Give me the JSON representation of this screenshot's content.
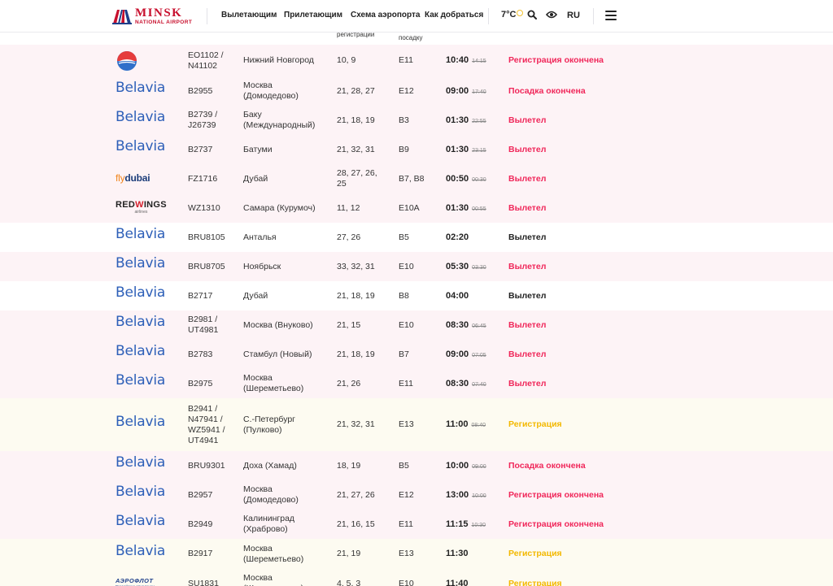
{
  "header": {
    "logo_main": "MINSK",
    "logo_sub": "NATIONAL AIRPORT",
    "nav": [
      "Вылетающим",
      "Прилетающим",
      "Схема аэропорта",
      "Как добраться"
    ],
    "weather": "7°C",
    "lang": "RU"
  },
  "columns": {
    "registration_fragment": "регистрации",
    "boarding_fragment": "посадку"
  },
  "colors": {
    "status_red": "#f0275a",
    "status_yellow": "#f3b800",
    "status_dark": "#222222",
    "belavia_blue": "#2d5fb8"
  },
  "flights": [
    {
      "airline": "uvt-aero",
      "airline_logo_icon": "uvt-aero-logo-icon",
      "flight": "EO1102 / N41102",
      "destination": "Нижний Новгород",
      "registration": "10, 9",
      "gate": "E11",
      "time": "10:40",
      "scheduled": "14:15",
      "status": "Регистрация окончена",
      "status_color": "red",
      "bg": "pink"
    },
    {
      "airline": "Belavia",
      "flight": "B2955",
      "destination": "Москва (Домодедово)",
      "registration": "21, 28, 27",
      "gate": "E12",
      "time": "09:00",
      "scheduled": "17:40",
      "status": "Посадка окончена",
      "status_color": "red",
      "bg": "pink"
    },
    {
      "airline": "Belavia",
      "flight": "B2739 / J26739",
      "destination": "Баку (Международный)",
      "registration": "21, 18, 19",
      "gate": "B3",
      "time": "01:30",
      "scheduled": "22:55",
      "status": "Вылетел",
      "status_color": "red",
      "bg": "pink"
    },
    {
      "airline": "Belavia",
      "flight": "B2737",
      "destination": "Батуми",
      "registration": "21, 32, 31",
      "gate": "B9",
      "time": "01:30",
      "scheduled": "23:15",
      "status": "Вылетел",
      "status_color": "red",
      "bg": "pink"
    },
    {
      "airline": "flydubai",
      "flight": "FZ1716",
      "destination": "Дубай",
      "registration": "28, 27, 26, 25",
      "gate": "B7, B8",
      "time": "00:50",
      "scheduled": "00:30",
      "status": "Вылетел",
      "status_color": "red",
      "bg": "pink"
    },
    {
      "airline": "REDWINGS",
      "airline_sub": "airlines",
      "flight": "WZ1310",
      "destination": "Самара (Курумоч)",
      "registration": "11, 12",
      "gate": "E10A",
      "time": "01:30",
      "scheduled": "00:55",
      "status": "Вылетел",
      "status_color": "red",
      "bg": "pink"
    },
    {
      "airline": "Belavia",
      "flight": "BRU8105",
      "destination": "Анталья",
      "registration": "27, 26",
      "gate": "B5",
      "time": "02:20",
      "scheduled": "",
      "status": "Вылетел",
      "status_color": "dark",
      "bg": "white"
    },
    {
      "airline": "Belavia",
      "flight": "BRU8705",
      "destination": "Ноябрьск",
      "registration": "33, 32, 31",
      "gate": "E10",
      "time": "05:30",
      "scheduled": "03:30",
      "status": "Вылетел",
      "status_color": "red",
      "bg": "pink"
    },
    {
      "airline": "Belavia",
      "flight": "B2717",
      "destination": "Дубай",
      "registration": "21, 18, 19",
      "gate": "B8",
      "time": "04:00",
      "scheduled": "",
      "status": "Вылетел",
      "status_color": "dark",
      "bg": "white"
    },
    {
      "airline": "Belavia",
      "flight": "B2981 / UT4981",
      "destination": "Москва (Внуково)",
      "registration": "21, 15",
      "gate": "E10",
      "time": "08:30",
      "scheduled": "06:45",
      "status": "Вылетел",
      "status_color": "red",
      "bg": "pink"
    },
    {
      "airline": "Belavia",
      "flight": "B2783",
      "destination": "Стамбул (Новый)",
      "registration": "21, 18, 19",
      "gate": "B7",
      "time": "09:00",
      "scheduled": "07:05",
      "status": "Вылетел",
      "status_color": "red",
      "bg": "pink"
    },
    {
      "airline": "Belavia",
      "flight": "B2975",
      "destination": "Москва (Шереметьево)",
      "registration": "21, 26",
      "gate": "E11",
      "time": "08:30",
      "scheduled": "07:40",
      "status": "Вылетел",
      "status_color": "red",
      "bg": "pink"
    },
    {
      "airline": "Belavia",
      "flight": "B2941 / N47941 / WZ5941 / UT4941",
      "destination": "С.-Петербург (Пулково)",
      "registration": "21, 32, 31",
      "gate": "E13",
      "time": "11:00",
      "scheduled": "08:40",
      "status": "Регистрация",
      "status_color": "yellow",
      "bg": "cream"
    },
    {
      "airline": "Belavia",
      "flight": "BRU9301",
      "destination": "Доха (Хамад)",
      "registration": "18, 19",
      "gate": "B5",
      "time": "10:00",
      "scheduled": "09:00",
      "status": "Посадка окончена",
      "status_color": "red",
      "bg": "pink"
    },
    {
      "airline": "Belavia",
      "flight": "B2957",
      "destination": "Москва (Домодедово)",
      "registration": "21, 27, 26",
      "gate": "E12",
      "time": "13:00",
      "scheduled": "10:00",
      "status": "Регистрация окончена",
      "status_color": "red",
      "bg": "pink"
    },
    {
      "airline": "Belavia",
      "flight": "B2949",
      "destination": "Калининград (Храброво)",
      "registration": "21, 16, 15",
      "gate": "E11",
      "time": "11:15",
      "scheduled": "10:30",
      "status": "Регистрация окончена",
      "status_color": "red",
      "bg": "pink"
    },
    {
      "airline": "Belavia",
      "flight": "B2917",
      "destination": "Москва (Шереметьево)",
      "registration": "21, 19",
      "gate": "E13",
      "time": "11:30",
      "scheduled": "",
      "status": "Регистрация",
      "status_color": "yellow",
      "bg": "cream"
    },
    {
      "airline": "АЭРОФЛОТ",
      "airline_sub": "Российские авиалинии",
      "flight": "SU1831",
      "destination": "Москва (Шереметьево)",
      "registration": "4, 5, 3",
      "gate": "E10",
      "time": "11:40",
      "scheduled": "",
      "status": "Регистрация",
      "status_color": "yellow",
      "bg": "cream"
    }
  ]
}
